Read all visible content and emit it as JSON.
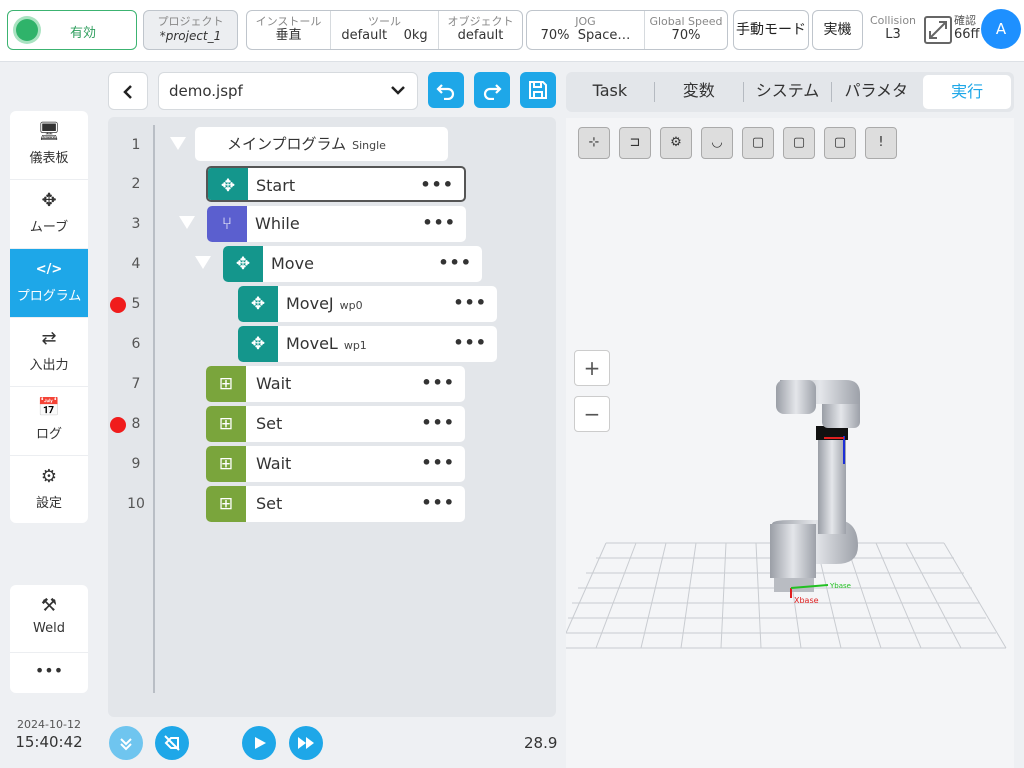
{
  "status": {
    "enabled_label": "有効"
  },
  "project": {
    "label": "プロジェクト",
    "name": "*project_1"
  },
  "tool_group": {
    "install_label": "インストール",
    "install_value": "垂直",
    "tool_label": "ツール",
    "tool_value": "default",
    "payload": "0kg",
    "object_label": "オブジェクト",
    "object_value": "default"
  },
  "motion_group": {
    "jog_label": "JOG",
    "jog_value": "70%",
    "space_value": "Space…",
    "speed_label": "Global Speed",
    "speed_value": "70%"
  },
  "mode_button": "手動モード",
  "real_button": "実機",
  "collision": {
    "label": "Collision",
    "value": "L3"
  },
  "confirm": {
    "label": "確認",
    "value": "66ff"
  },
  "avatar": "A",
  "nav": [
    {
      "icon": "🖥",
      "label": "儀表板"
    },
    {
      "icon": "✥",
      "label": "ムーブ"
    },
    {
      "icon": "</>",
      "label": "プログラム"
    },
    {
      "icon": "⇄",
      "label": "入出力"
    },
    {
      "icon": "📅",
      "label": "ログ"
    },
    {
      "icon": "⚙",
      "label": "設定"
    }
  ],
  "weld": {
    "icon": "⚒",
    "label": "Weld"
  },
  "more": "•••",
  "clock": {
    "date": "2024-10-12",
    "time": "15:40:42"
  },
  "file": {
    "name": "demo.jspf"
  },
  "tree": {
    "main_label": "メインプログラム",
    "main_sub": "Single",
    "line_numbers": [
      "1",
      "2",
      "3",
      "4",
      "5",
      "6",
      "7",
      "8",
      "9",
      "10"
    ],
    "nodes": [
      {
        "label": "Start",
        "sub": "",
        "color": "#14968c"
      },
      {
        "label": "While",
        "sub": "",
        "color": "#5b5fcf"
      },
      {
        "label": "Move",
        "sub": "",
        "color": "#14968c"
      },
      {
        "label": "MoveJ",
        "sub": "wp0",
        "color": "#14968c"
      },
      {
        "label": "MoveL",
        "sub": "wp1",
        "color": "#14968c"
      },
      {
        "label": "Wait",
        "sub": "",
        "color": "#7aa53c"
      },
      {
        "label": "Set",
        "sub": "",
        "color": "#7aa53c"
      },
      {
        "label": "Wait",
        "sub": "",
        "color": "#7aa53c"
      },
      {
        "label": "Set",
        "sub": "",
        "color": "#7aa53c"
      }
    ],
    "dots": "•••"
  },
  "footer_value": "28.9",
  "tabs": [
    {
      "label": "Task"
    },
    {
      "label": "変数"
    },
    {
      "label": "システム"
    },
    {
      "label": "パラメタ"
    },
    {
      "label": "実行"
    }
  ],
  "view_toolbar": [
    "⊹",
    "⊐",
    "⚙",
    "◡",
    "▢",
    "▢",
    "▢",
    "!"
  ],
  "zoom_in": "+",
  "zoom_out": "−",
  "axis_x": "Xbase",
  "axis_y": "Ybase"
}
